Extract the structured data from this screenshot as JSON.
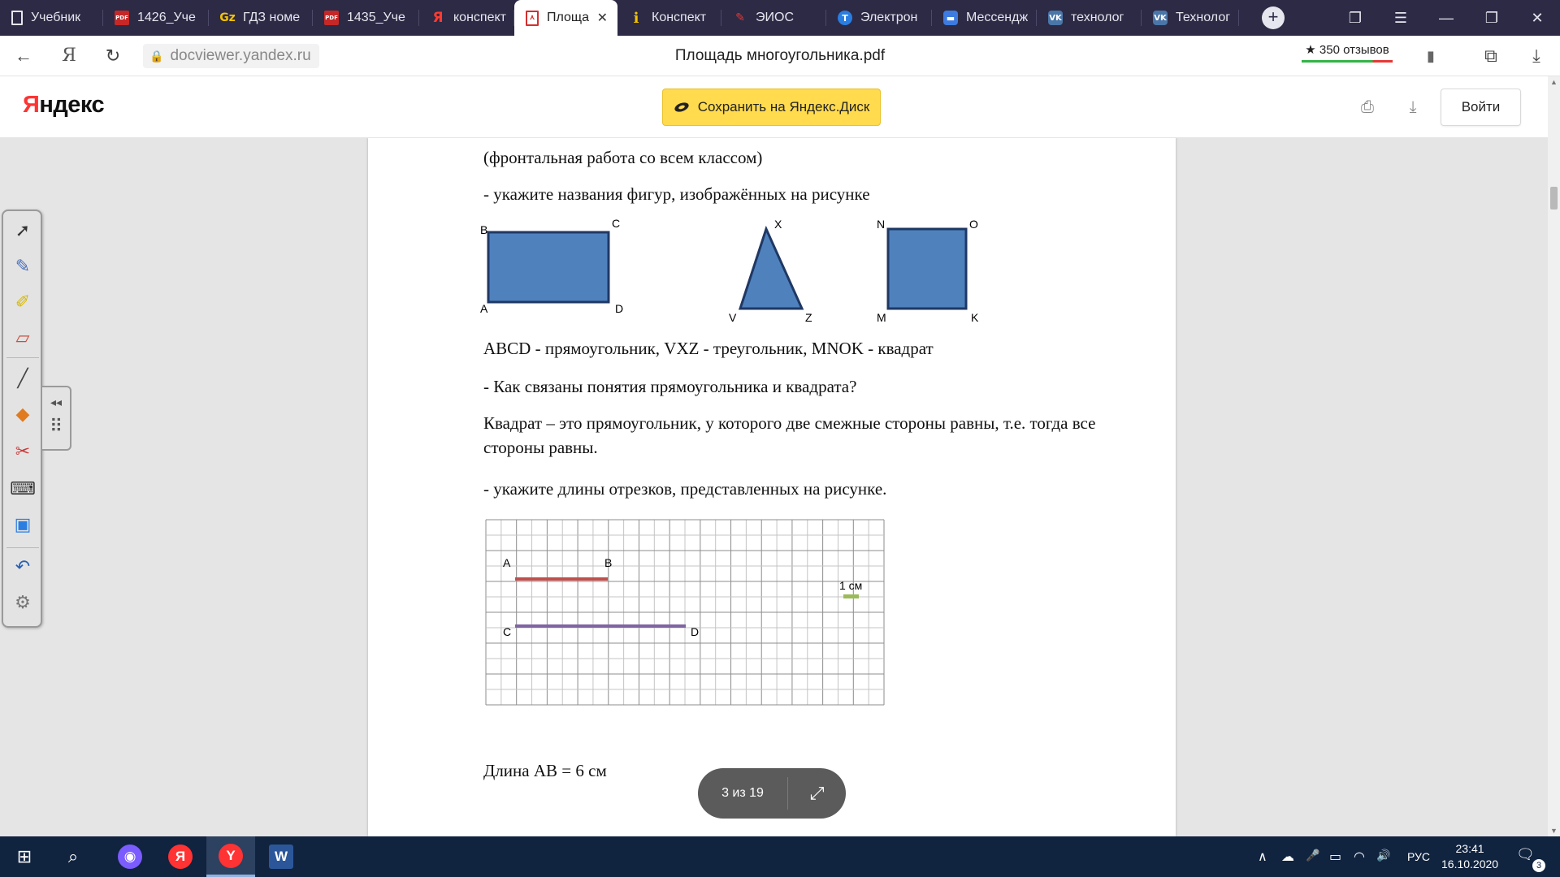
{
  "browser": {
    "tabs": [
      {
        "label": "Учебник",
        "favicon": "doc",
        "icon_name": "document-icon"
      },
      {
        "label": "1426_Уче",
        "favicon": "pdf",
        "icon_name": "pdf-icon"
      },
      {
        "label": "ГДЗ номе",
        "favicon": "gdz",
        "icon_name": "gdz-icon"
      },
      {
        "label": "1435_Уче",
        "favicon": "pdf",
        "icon_name": "pdf-icon"
      },
      {
        "label": "конспект",
        "favicon": "ya",
        "icon_name": "yandex-icon"
      },
      {
        "label": "Площа",
        "favicon": "pdfout",
        "icon_name": "pdf-icon",
        "active": true
      },
      {
        "label": "Конспект",
        "favicon": "i",
        "icon_name": "info-icon"
      },
      {
        "label": "ЭИОС",
        "favicon": "eios",
        "icon_name": "eios-icon"
      },
      {
        "label": "Электрон",
        "favicon": "el",
        "icon_name": "e-journal-icon"
      },
      {
        "label": "Мессендж",
        "favicon": "msg",
        "icon_name": "messenger-icon"
      },
      {
        "label": "технолог",
        "favicon": "vk",
        "icon_name": "vk-icon"
      },
      {
        "label": "Технолог",
        "favicon": "vk",
        "icon_name": "vk-icon"
      }
    ],
    "fav_text": {
      "pdf": "PDF",
      "gdz": "Gz",
      "ya": "Я",
      "i": "i",
      "eios": "✎",
      "el": "Т",
      "msg": "▬",
      "vk": "VK",
      "pdfout": "⋏",
      "doc": ""
    },
    "new_tab": "+",
    "url": "docviewer.yandex.ru",
    "page_title": "Площадь многоугольника.pdf",
    "reviews": "★ 350 отзывов",
    "icons": {
      "back": "←",
      "ya": "Я",
      "reload": "↻",
      "lock": "🔒",
      "bookmark": "▮",
      "tabs_stack": "❐",
      "menu": "☰",
      "minimize": "—",
      "restore": "❐",
      "close": "✕",
      "download": "⤓",
      "collections": "⧉"
    }
  },
  "yandex_header": {
    "logo_y": "Я",
    "logo_rest": "ндекс",
    "save_button": "Сохранить на Яндекс.Диск",
    "login_button": "Войти",
    "print_icon": "⎙",
    "download_icon": "⤓"
  },
  "document": {
    "lines": {
      "frontal": "(фронтальная работа со всем классом)",
      "q_names": "- укажите названия фигур, изображённых на рисунке",
      "answer_names": "ABCD - прямоугольник, VXZ - треугольник, MNOK - квадрат",
      "q_relation": "- Как связаны понятия прямоугольника и квадрата?",
      "answer_relation": "Квадрат – это прямоугольник, у которого две смежные стороны равны, т.е. тогда все стороны равны.",
      "q_lengths": "- укажите длины отрезков, представленных на рисунке.",
      "answer_ab": "Длина AB = 6 см"
    },
    "shapes": {
      "rect_labels": {
        "a": "A",
        "b": "B",
        "c": "C",
        "d": "D"
      },
      "triangle_labels": {
        "x": "X",
        "v": "V",
        "z": "Z"
      },
      "square_labels": {
        "n": "N",
        "o": "O",
        "m": "M",
        "k": "K"
      },
      "fill_color": "#4f81bd",
      "stroke_color": "#1f3864"
    },
    "grid_figure": {
      "columns": 26,
      "rows": 12,
      "cell_unit": "0.5 см",
      "segments": [
        {
          "name": "AB",
          "start_label": "A",
          "end_label": "B",
          "length_cm": 6,
          "color": "#c0504d"
        },
        {
          "name": "CD",
          "start_label": "C",
          "end_label": "D",
          "length_cm": 11,
          "color": "#8064a2"
        }
      ],
      "unit_label": "1 см",
      "unit_color": "#9bbb59"
    }
  },
  "viewer": {
    "page_counter": "3 из 19",
    "expand_icon": "⤢"
  },
  "pen_toolbar": {
    "tools": [
      "select-arrow-icon",
      "pen-icon",
      "highlighter-icon",
      "eraser-icon",
      "line-icon",
      "shapes-icon",
      "clear-icon",
      "keyboard-icon",
      "notes-icon",
      "undo-icon",
      "settings-icon"
    ],
    "glyphs": [
      "➚",
      "✎",
      "✐",
      "▱",
      "╱",
      "◆",
      "✂",
      "⌨",
      "▣",
      "↶",
      "⚙"
    ],
    "side_glyphs": [
      "◂◂",
      "⠿"
    ]
  },
  "taskbar": {
    "start": "⊞",
    "search": "⌕",
    "apps": [
      {
        "name": "alice-icon",
        "glyph": "◉",
        "color": "#7b5cff"
      },
      {
        "name": "yandex-app-icon",
        "glyph": "Я",
        "color": "#ff3333"
      },
      {
        "name": "yandex-browser-icon",
        "glyph": "Y",
        "color": "#ff3333",
        "active": true
      },
      {
        "name": "word-icon",
        "glyph": "W",
        "color": "#2b579a"
      }
    ],
    "tray": {
      "chevron": "∧",
      "cloud": "☁",
      "mic": "🎤",
      "battery": "▭",
      "wifi": "◠",
      "volume": "🔊",
      "lang": "РУС",
      "notifications": "🗨",
      "notif_count": "3"
    },
    "time": "23:41",
    "date": "16.10.2020"
  }
}
